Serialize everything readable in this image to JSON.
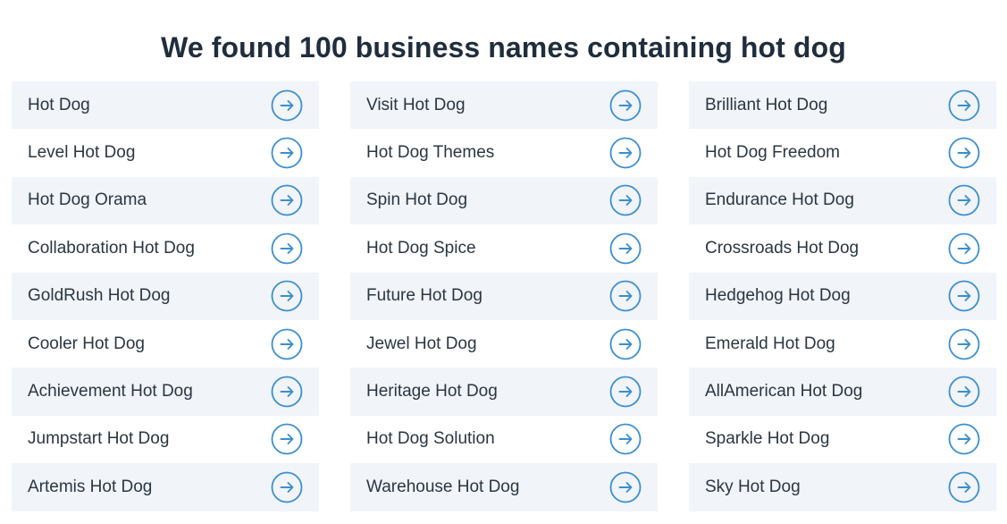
{
  "header": {
    "title": "We found 100 business names containing hot dog"
  },
  "colors": {
    "accent": "#3b8fd0",
    "row_alt_bg": "#f1f4f9",
    "title_text": "#1f2d3d",
    "item_text": "#2b3642"
  },
  "columns": [
    {
      "items": [
        {
          "label": "Hot Dog",
          "icon": "arrow-right-circle-icon"
        },
        {
          "label": "Level Hot Dog",
          "icon": "arrow-right-circle-icon"
        },
        {
          "label": "Hot Dog Orama",
          "icon": "arrow-right-circle-icon"
        },
        {
          "label": "Collaboration Hot Dog",
          "icon": "arrow-right-circle-icon"
        },
        {
          "label": "GoldRush Hot Dog",
          "icon": "arrow-right-circle-icon"
        },
        {
          "label": "Cooler Hot Dog",
          "icon": "arrow-right-circle-icon"
        },
        {
          "label": "Achievement Hot Dog",
          "icon": "arrow-right-circle-icon"
        },
        {
          "label": "Jumpstart Hot Dog",
          "icon": "arrow-right-circle-icon"
        },
        {
          "label": "Artemis Hot Dog",
          "icon": "arrow-right-circle-icon"
        }
      ]
    },
    {
      "items": [
        {
          "label": "Visit Hot Dog",
          "icon": "arrow-right-circle-icon"
        },
        {
          "label": "Hot Dog Themes",
          "icon": "arrow-right-circle-icon"
        },
        {
          "label": "Spin Hot Dog",
          "icon": "arrow-right-circle-icon"
        },
        {
          "label": "Hot Dog Spice",
          "icon": "arrow-right-circle-icon"
        },
        {
          "label": "Future Hot Dog",
          "icon": "arrow-right-circle-icon"
        },
        {
          "label": "Jewel Hot Dog",
          "icon": "arrow-right-circle-icon"
        },
        {
          "label": "Heritage Hot Dog",
          "icon": "arrow-right-circle-icon"
        },
        {
          "label": "Hot Dog Solution",
          "icon": "arrow-right-circle-icon"
        },
        {
          "label": "Warehouse Hot Dog",
          "icon": "arrow-right-circle-icon"
        }
      ]
    },
    {
      "items": [
        {
          "label": "Brilliant Hot Dog",
          "icon": "arrow-right-circle-icon"
        },
        {
          "label": "Hot Dog Freedom",
          "icon": "arrow-right-circle-icon"
        },
        {
          "label": "Endurance Hot Dog",
          "icon": "arrow-right-circle-icon"
        },
        {
          "label": "Crossroads Hot Dog",
          "icon": "arrow-right-circle-icon"
        },
        {
          "label": "Hedgehog Hot Dog",
          "icon": "arrow-right-circle-icon"
        },
        {
          "label": "Emerald Hot Dog",
          "icon": "arrow-right-circle-icon"
        },
        {
          "label": "AllAmerican Hot Dog",
          "icon": "arrow-right-circle-icon"
        },
        {
          "label": "Sparkle Hot Dog",
          "icon": "arrow-right-circle-icon"
        },
        {
          "label": "Sky Hot Dog",
          "icon": "arrow-right-circle-icon"
        }
      ]
    }
  ]
}
